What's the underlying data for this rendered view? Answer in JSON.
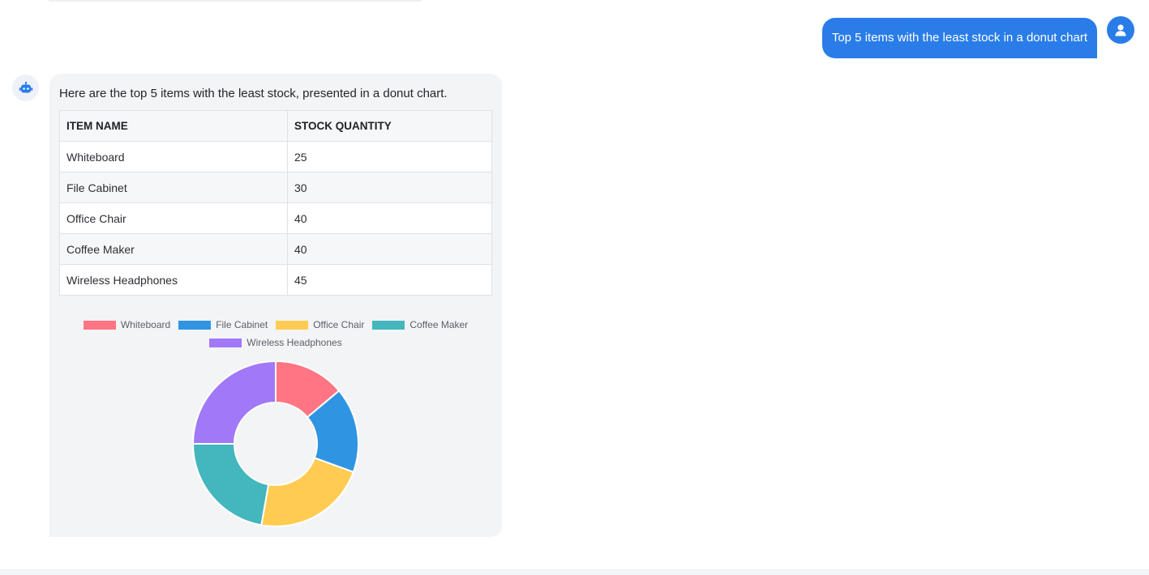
{
  "user_message": {
    "text": "Top 5 items with the least stock in a donut chart",
    "avatar_icon": "user-icon",
    "color": "#2a7de8"
  },
  "bot_message": {
    "avatar_icon": "robot-icon",
    "intro": "Here are the top 5 items with the least stock, presented in a donut chart.",
    "table": {
      "headers": [
        "ITEM NAME",
        "STOCK QUANTITY"
      ],
      "rows": [
        [
          "Whiteboard",
          "25"
        ],
        [
          "File Cabinet",
          "30"
        ],
        [
          "Office Chair",
          "40"
        ],
        [
          "Coffee Maker",
          "40"
        ],
        [
          "Wireless Headphones",
          "45"
        ]
      ]
    }
  },
  "chart_data": {
    "type": "pie",
    "variant": "donut",
    "categories": [
      "Whiteboard",
      "File Cabinet",
      "Office Chair",
      "Coffee Maker",
      "Wireless Headphones"
    ],
    "values": [
      25,
      30,
      40,
      40,
      45
    ],
    "colors": [
      "#ff7583",
      "#2f95e3",
      "#ffcb52",
      "#44b6bd",
      "#a178f7"
    ],
    "legend_position": "top",
    "title": ""
  }
}
